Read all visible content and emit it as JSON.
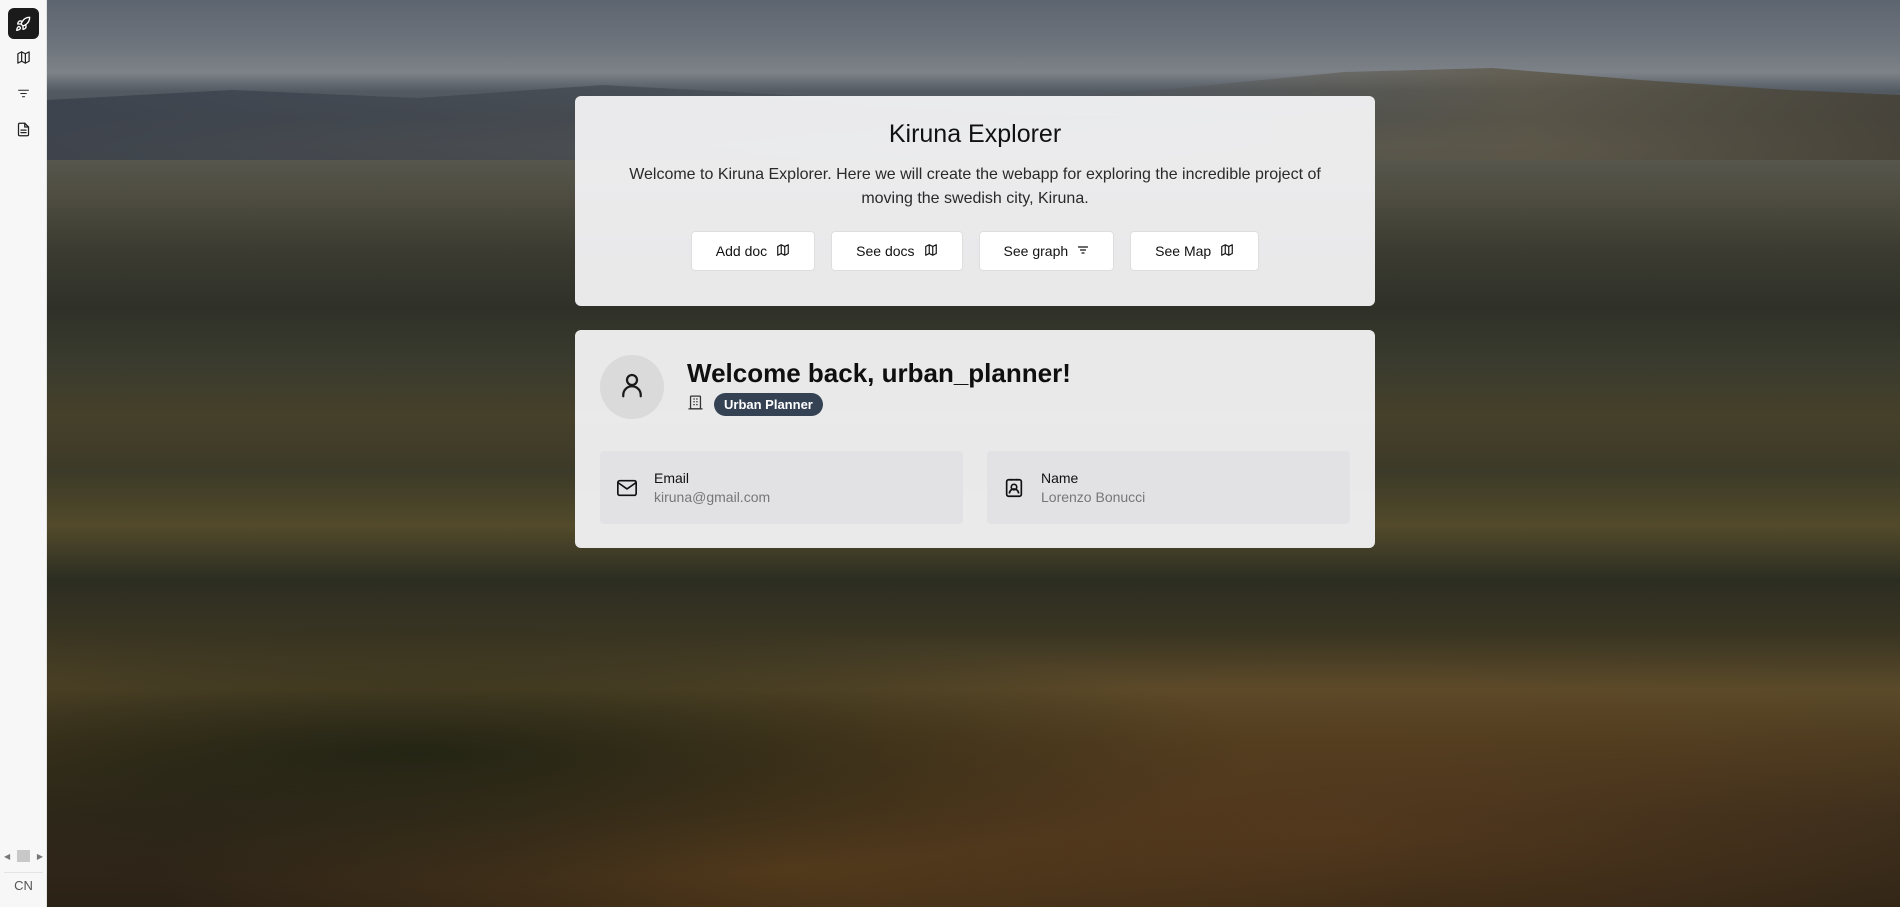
{
  "sidebar": {
    "logo_icon": "rocket-icon",
    "items": [
      {
        "name": "map",
        "icon": "map-icon"
      },
      {
        "name": "graph",
        "icon": "list-icon"
      },
      {
        "name": "docs",
        "icon": "document-icon"
      }
    ],
    "language": "CN"
  },
  "intro": {
    "title": "Kiruna Explorer",
    "description": "Welcome to Kiruna Explorer. Here we will create the webapp for exploring the incredible project of moving the swedish city, Kiruna.",
    "buttons": [
      {
        "label": "Add doc",
        "icon": "map-icon"
      },
      {
        "label": "See docs",
        "icon": "map-icon"
      },
      {
        "label": "See graph",
        "icon": "list-icon"
      },
      {
        "label": "See Map",
        "icon": "map-icon"
      }
    ]
  },
  "profile": {
    "welcome": "Welcome back, urban_planner!",
    "role": "Urban Planner",
    "email_label": "Email",
    "email_value": "kiruna@gmail.com",
    "name_label": "Name",
    "name_value": "Lorenzo Bonucci"
  },
  "colors": {
    "badge": "#344254",
    "logo_bg": "#1b1b1b"
  }
}
